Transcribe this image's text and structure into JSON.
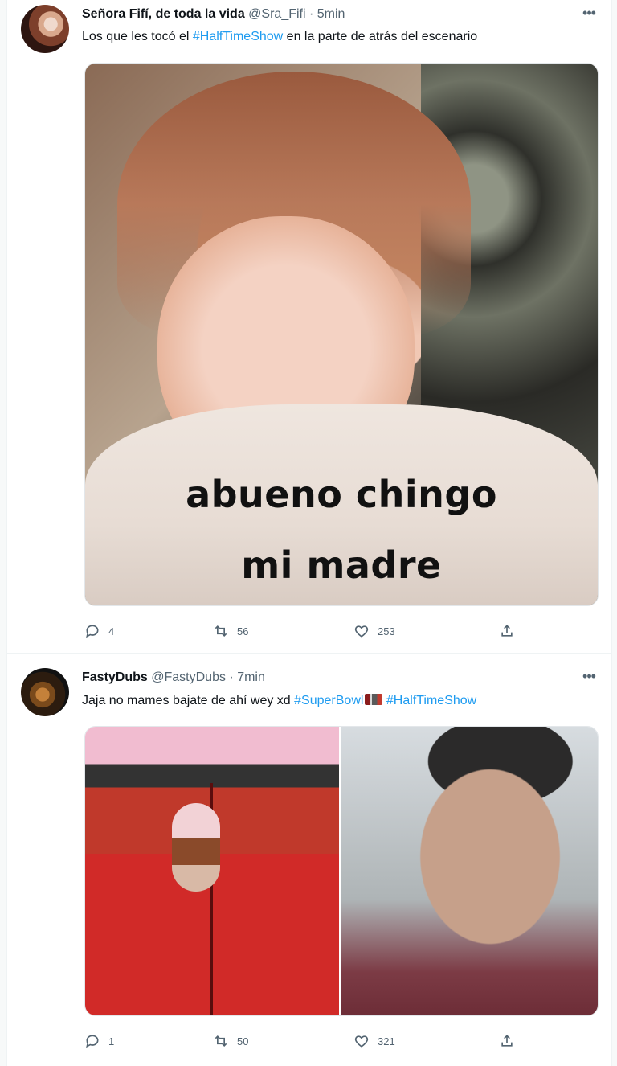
{
  "tweets": [
    {
      "name": "Señora Fifí, de toda la vida",
      "handle": "@Sra_Fifi",
      "time": "· 5min",
      "text_before": "Los que les tocó el ",
      "hashtag1": "#HalfTimeShow",
      "text_after": " en la parte de atrás del escenario",
      "meme_line1": "abueno chingo",
      "meme_line2": "mi madre",
      "replies": "4",
      "retweets": "56",
      "likes": "253"
    },
    {
      "name": "FastyDubs",
      "handle": "@FastyDubs",
      "time": "· 7min",
      "text_before": "Jaja no mames bajate de ahí wey xd ",
      "hashtag1": "#SuperBowl",
      "hashtag2": "#HalfTimeShow",
      "replies": "1",
      "retweets": "50",
      "likes": "321"
    }
  ],
  "more_glyph": "•••",
  "icons": [
    "reply-icon",
    "retweet-icon",
    "like-icon",
    "share-icon",
    "more-icon"
  ]
}
